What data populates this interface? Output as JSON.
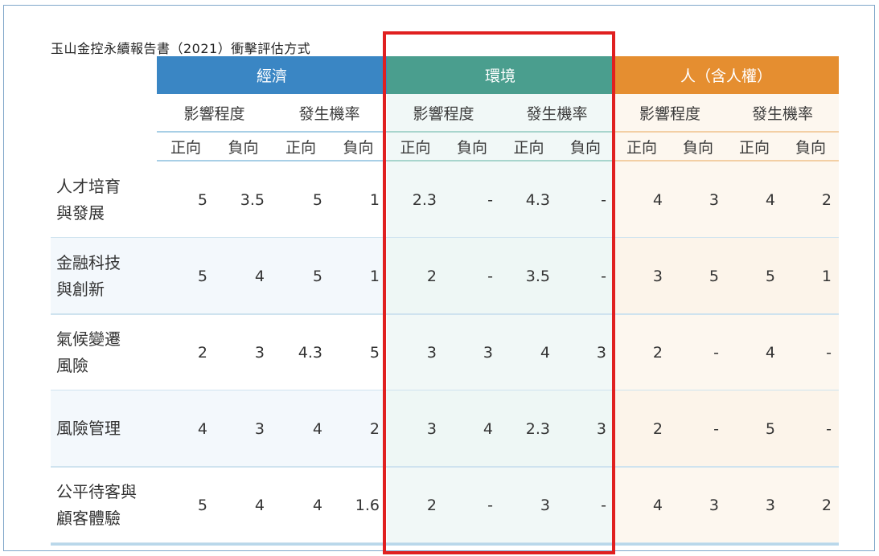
{
  "title": "玉山金控永續報告書（2021）衝擊評估方式",
  "groups": {
    "economy": "經濟",
    "environment": "環境",
    "people": "人（含人權）"
  },
  "sub_headers": {
    "impact": "影響程度",
    "probability": "發生機率"
  },
  "directions": {
    "positive": "正向",
    "negative": "負向"
  },
  "rows": [
    {
      "label": "人才培育\n與發展",
      "values": [
        "5",
        "3.5",
        "5",
        "1",
        "2.3",
        "-",
        "4.3",
        "-",
        "4",
        "3",
        "4",
        "2"
      ]
    },
    {
      "label": "金融科技\n與創新",
      "values": [
        "5",
        "4",
        "5",
        "1",
        "2",
        "-",
        "3.5",
        "-",
        "3",
        "5",
        "5",
        "1"
      ]
    },
    {
      "label": "氣候變遷\n風險",
      "values": [
        "2",
        "3",
        "4.3",
        "5",
        "3",
        "3",
        "4",
        "3",
        "2",
        "-",
        "4",
        "-"
      ]
    },
    {
      "label": "風險管理",
      "values": [
        "4",
        "3",
        "4",
        "2",
        "3",
        "4",
        "2.3",
        "3",
        "2",
        "-",
        "5",
        "-"
      ]
    },
    {
      "label": "公平待客與\n顧客體驗",
      "values": [
        "5",
        "4",
        "4",
        "1.6",
        "2",
        "-",
        "3",
        "-",
        "4",
        "3",
        "3",
        "2"
      ]
    }
  ],
  "colors": {
    "economy": "#3a86c4",
    "environment": "#4a9e8e",
    "people": "#e58e30",
    "highlight": "#e02020"
  }
}
